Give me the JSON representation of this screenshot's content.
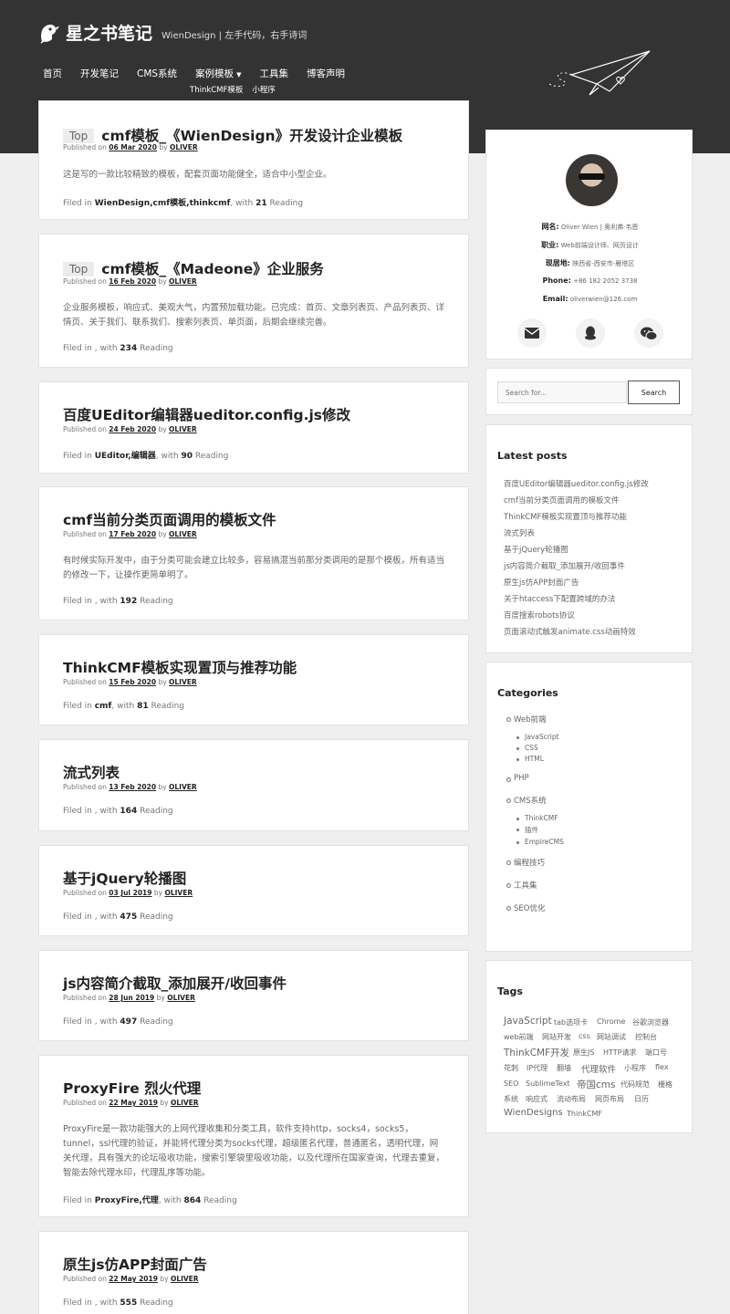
{
  "site": {
    "title": "星之书笔记",
    "description": "WienDesign | 左手代码，右手诗词"
  },
  "nav": {
    "items": [
      "首页",
      "开发笔记",
      "CMS系统",
      "案例模板",
      "工具集",
      "博客声明"
    ],
    "dropdown_caret": "▼",
    "sub_items": [
      "ThinkCMF模板",
      "小程序"
    ]
  },
  "posts": [
    {
      "top": "Top",
      "title": "cmf模板_《WienDesign》开发设计企业模板",
      "published_prefix": "Published on",
      "date": "06 Mar 2020",
      "by": "by",
      "author": "OLIVER",
      "excerpt": "这是写的一款比较精致的模板，配套页面功能健全，适合中小型企业。",
      "filed_prefix": "Filed in",
      "filed_in": "WienDesign,cmf模板,thinkcmf",
      "with": ", with",
      "reading": "21",
      "reading_label": "Reading"
    },
    {
      "top": "Top",
      "title": "cmf模板_《Madeone》企业服务",
      "published_prefix": "Published on",
      "date": "16 Feb 2020",
      "by": "by",
      "author": "OLIVER",
      "excerpt": "企业服务模板，响应式、美观大气，内置预加载功能。已完成：首页、文章列表页、产品列表页、详情页、关于我们、联系我们、搜索列表页、单页面，后期会继续完善。",
      "filed_prefix": "Filed in",
      "filed_in": "",
      "with": ", with",
      "reading": "234",
      "reading_label": "Reading"
    },
    {
      "title": "百度UEditor编辑器ueditor.config.js修改",
      "published_prefix": "Published on",
      "date": "24 Feb 2020",
      "by": "by",
      "author": "OLIVER",
      "filed_prefix": "Filed in",
      "filed_in": "UEditor,编辑器",
      "with": ", with",
      "reading": "90",
      "reading_label": "Reading"
    },
    {
      "title": "cmf当前分类页面调用的模板文件",
      "published_prefix": "Published on",
      "date": "17 Feb 2020",
      "by": "by",
      "author": "OLIVER",
      "excerpt": "有时候实际开发中，由于分类可能会建立比较多，容易搞混当前那分类调用的是那个模板，所有适当的修改一下，让操作更简单明了。",
      "filed_prefix": "Filed in",
      "filed_in": "",
      "with": ", with",
      "reading": "192",
      "reading_label": "Reading"
    },
    {
      "title": "ThinkCMF模板实现置顶与推荐功能",
      "published_prefix": "Published on",
      "date": "15 Feb 2020",
      "by": "by",
      "author": "OLIVER",
      "filed_prefix": "Filed in",
      "filed_in": "cmf",
      "with": ", with",
      "reading": "81",
      "reading_label": "Reading"
    },
    {
      "title": "流式列表",
      "published_prefix": "Published on",
      "date": "13 Feb 2020",
      "by": "by",
      "author": "OLIVER",
      "filed_prefix": "Filed in",
      "filed_in": "",
      "with": ", with",
      "reading": "164",
      "reading_label": "Reading"
    },
    {
      "title": "基于jQuery轮播图",
      "published_prefix": "Published on",
      "date": "03 Jul 2019",
      "by": "by",
      "author": "OLIVER",
      "filed_prefix": "Filed in",
      "filed_in": "",
      "with": ", with",
      "reading": "475",
      "reading_label": "Reading"
    },
    {
      "title": "js内容简介截取_添加展开/收回事件",
      "published_prefix": "Published on",
      "date": "28 Jun 2019",
      "by": "by",
      "author": "OLIVER",
      "filed_prefix": "Filed in",
      "filed_in": "",
      "with": ", with",
      "reading": "497",
      "reading_label": "Reading"
    },
    {
      "title": "ProxyFire 烈火代理",
      "published_prefix": "Published on",
      "date": "22 May 2019",
      "by": "by",
      "author": "OLIVER",
      "excerpt": "ProxyFire是一款功能强大的上网代理收集和分类工具，软件支持http，socks4，socks5，tunnel，ssl代理的验证，并能将代理分类为socks代理，超级匿名代理，普通匿名，透明代理，网关代理，具有强大的论坛吸收功能，搜索引擎袋里吸收功能，以及代理所在国家查询，代理去重复，智能去除代理水印，代理乱序等功能。",
      "filed_prefix": "Filed in",
      "filed_in": "ProxyFire,代理",
      "with": ", with",
      "reading": "864",
      "reading_label": "Reading"
    },
    {
      "title": "原生js仿APP封面广告",
      "published_prefix": "Published on",
      "date": "22 May 2019",
      "by": "by",
      "author": "OLIVER",
      "filed_prefix": "Filed in",
      "filed_in": "",
      "with": ", with",
      "reading": "555",
      "reading_label": "Reading"
    }
  ],
  "profile": {
    "rows": [
      {
        "label": "网名:",
        "value": "Oliver Wien | 奥利弗·韦恩"
      },
      {
        "label": "职业:",
        "value": "Web前端设计师、网页设计"
      },
      {
        "label": "现居地:",
        "value": "陕西省-西安市-雁塔区"
      },
      {
        "label": "Phone:",
        "value": "+86 182 2052 3738"
      },
      {
        "label": "Email:",
        "value": "oliverwien@126.com"
      }
    ]
  },
  "search": {
    "placeholder": "Search for...",
    "button": "Search"
  },
  "latest": {
    "title": "Latest posts",
    "items": [
      "百度UEditor编辑器ueditor.config.js修改",
      "cmf当前分类页面调用的模板文件",
      "ThinkCMF模板实现置顶与推荐功能",
      "流式列表",
      "基于jQuery轮播图",
      "js内容简介截取_添加展开/收回事件",
      "原生js仿APP封面广告",
      "关于htaccess下配置跨域的办法",
      "百度搜索robots协议",
      "页面滚动式触发animate.css动画特效"
    ]
  },
  "categories": {
    "title": "Categories",
    "web": "Web前端",
    "web_children": [
      "JavaScript",
      "CSS",
      "HTML"
    ],
    "php": "PHP",
    "cms": "CMS系统",
    "cms_children": [
      "ThinkCMF",
      "插件",
      "EmpireCMS"
    ],
    "skills": "编程技巧",
    "tools": "工具集",
    "seo": "SEO优化"
  },
  "tags": {
    "title": "Tags",
    "items": [
      "JavaScript",
      "tab选项卡",
      "Chrome",
      "谷歌浏览器",
      "web前端",
      "网站开发",
      "css",
      "网站调试",
      "控制台",
      "ThinkCMF开发",
      "原生JS",
      "HTTP请求",
      "端口号",
      "花刺",
      "IP代理",
      "翻墙",
      "代理软件",
      "小程序",
      "flex",
      "SEO",
      "SublimeText",
      "帝国cms",
      "代码规范",
      "栅格",
      "系统",
      "响应式",
      "流动布局",
      "网页布局",
      "日历",
      "WienDesigns",
      "ThinkCMF"
    ]
  }
}
